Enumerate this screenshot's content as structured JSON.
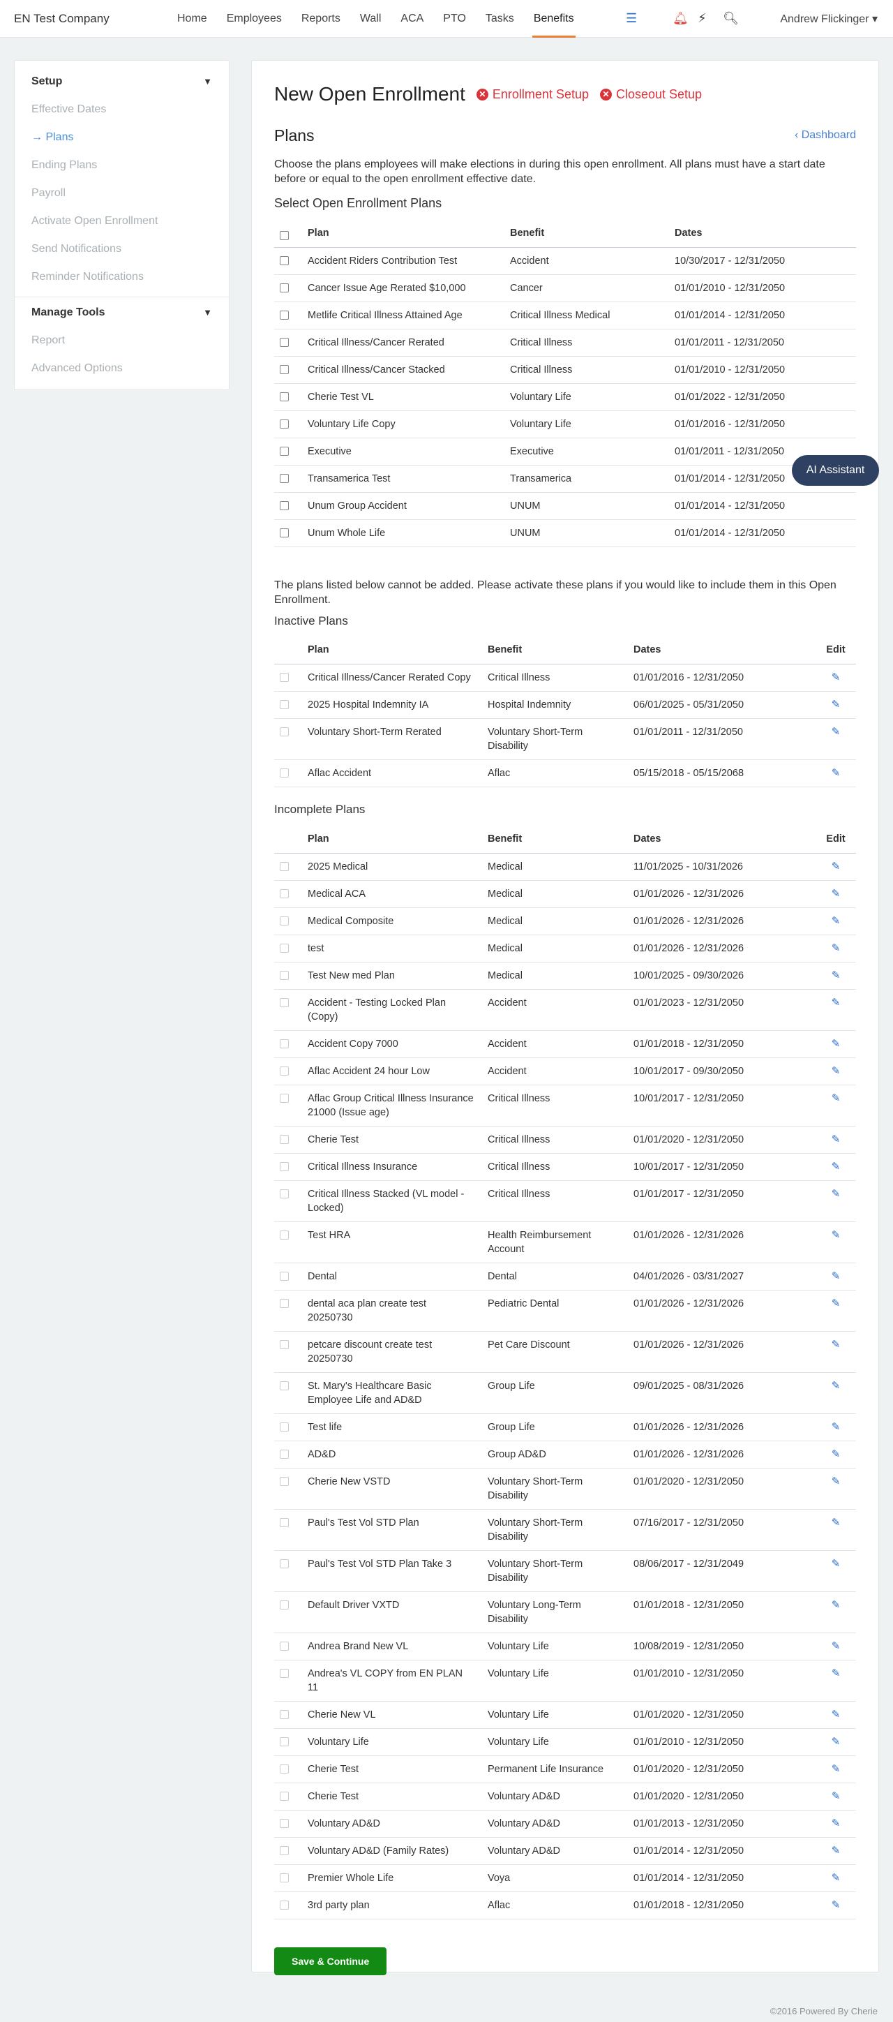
{
  "header": {
    "company": "EN Test Company",
    "nav": [
      "Home",
      "Employees",
      "Reports",
      "Wall",
      "ACA",
      "PTO",
      "Tasks",
      "Benefits"
    ],
    "user": "Andrew Flickinger ▾"
  },
  "sidebar": {
    "setup_title": "Setup",
    "setup_items": [
      "Effective Dates",
      "Plans",
      "Ending Plans",
      "Payroll",
      "Activate Open Enrollment",
      "Send Notifications",
      "Reminder Notifications"
    ],
    "tools_title": "Manage Tools",
    "tools_items": [
      "Report",
      "Advanced Options"
    ]
  },
  "page": {
    "title": "New Open Enrollment",
    "enroll_setup": "Enrollment Setup",
    "closeout_setup": "Closeout Setup",
    "plans_heading": "Plans",
    "dashboard_link": "Dashboard",
    "intro": "Choose the plans employees will make elections in during this open enrollment. All plans must have a start date before or equal to the open enrollment effective date.",
    "select_heading": "Select Open Enrollment Plans",
    "notice": "The plans listed below cannot be added. Please activate these plans if you would like to include them in this Open Enrollment.",
    "inactive_heading": "Inactive Plans",
    "incomplete_heading": "Incomplete Plans",
    "save_button": "Save & Continue",
    "ai_button": "AI Assistant",
    "footer": "©2016 Powered By Cherie"
  },
  "columns": {
    "plan": "Plan",
    "benefit": "Benefit",
    "dates": "Dates",
    "edit": "Edit"
  },
  "select_plans": [
    [
      "Accident Riders Contribution Test",
      "Accident",
      "10/30/2017 - 12/31/2050"
    ],
    [
      "Cancer Issue Age Rerated $10,000",
      "Cancer",
      "01/01/2010 - 12/31/2050"
    ],
    [
      "Metlife Critical Illness Attained Age",
      "Critical Illness Medical",
      "01/01/2014 - 12/31/2050"
    ],
    [
      "Critical Illness/Cancer Rerated",
      "Critical Illness",
      "01/01/2011 - 12/31/2050"
    ],
    [
      "Critical Illness/Cancer Stacked",
      "Critical Illness",
      "01/01/2010 - 12/31/2050"
    ],
    [
      "Cherie Test VL",
      "Voluntary Life",
      "01/01/2022 - 12/31/2050"
    ],
    [
      "Voluntary Life Copy",
      "Voluntary Life",
      "01/01/2016 - 12/31/2050"
    ],
    [
      "Executive",
      "Executive",
      "01/01/2011 - 12/31/2050"
    ],
    [
      "Transamerica Test",
      "Transamerica",
      "01/01/2014 - 12/31/2050"
    ],
    [
      "Unum Group Accident",
      "UNUM",
      "01/01/2014 - 12/31/2050"
    ],
    [
      "Unum Whole Life",
      "UNUM",
      "01/01/2014 - 12/31/2050"
    ]
  ],
  "inactive_plans": [
    [
      "Critical Illness/Cancer Rerated Copy",
      "Critical Illness",
      "01/01/2016 - 12/31/2050"
    ],
    [
      "2025 Hospital Indemnity IA",
      "Hospital Indemnity",
      "06/01/2025 - 05/31/2050"
    ],
    [
      "Voluntary Short-Term Rerated",
      "Voluntary Short-Term Disability",
      "01/01/2011 - 12/31/2050"
    ],
    [
      "Aflac Accident",
      "Aflac",
      "05/15/2018 - 05/15/2068"
    ]
  ],
  "incomplete_plans": [
    [
      "2025 Medical",
      "Medical",
      "11/01/2025 - 10/31/2026"
    ],
    [
      "Medical ACA",
      "Medical",
      "01/01/2026 - 12/31/2026"
    ],
    [
      "Medical Composite",
      "Medical",
      "01/01/2026 - 12/31/2026"
    ],
    [
      "test",
      "Medical",
      "01/01/2026 - 12/31/2026"
    ],
    [
      "Test New med Plan",
      "Medical",
      "10/01/2025 - 09/30/2026"
    ],
    [
      "Accident - Testing Locked Plan (Copy)",
      "Accident",
      "01/01/2023 - 12/31/2050"
    ],
    [
      "Accident Copy 7000",
      "Accident",
      "01/01/2018 - 12/31/2050"
    ],
    [
      "Aflac Accident 24 hour Low",
      "Accident",
      "10/01/2017 - 09/30/2050"
    ],
    [
      "Aflac Group Critical Illness Insurance 21000 (Issue age)",
      "Critical Illness",
      "10/01/2017 - 12/31/2050"
    ],
    [
      "Cherie Test",
      "Critical Illness",
      "01/01/2020 - 12/31/2050"
    ],
    [
      "Critical Illness Insurance",
      "Critical Illness",
      "10/01/2017 - 12/31/2050"
    ],
    [
      "Critical Illness Stacked (VL model - Locked)",
      "Critical Illness",
      "01/01/2017 - 12/31/2050"
    ],
    [
      "Test HRA",
      "Health Reimbursement Account",
      "01/01/2026 - 12/31/2026"
    ],
    [
      "Dental",
      "Dental",
      "04/01/2026 - 03/31/2027"
    ],
    [
      "dental aca plan create test 20250730",
      "Pediatric Dental",
      "01/01/2026 - 12/31/2026"
    ],
    [
      "petcare discount create test 20250730",
      "Pet Care Discount",
      "01/01/2026 - 12/31/2026"
    ],
    [
      "St. Mary's Healthcare Basic Employee Life and AD&D",
      "Group Life",
      "09/01/2025 - 08/31/2026"
    ],
    [
      "Test life",
      "Group Life",
      "01/01/2026 - 12/31/2026"
    ],
    [
      "AD&D",
      "Group AD&D",
      "01/01/2026 - 12/31/2026"
    ],
    [
      "Cherie New VSTD",
      "Voluntary Short-Term Disability",
      "01/01/2020 - 12/31/2050"
    ],
    [
      "Paul's Test Vol STD Plan",
      "Voluntary Short-Term Disability",
      "07/16/2017 - 12/31/2050"
    ],
    [
      "Paul's Test Vol STD Plan Take 3",
      "Voluntary Short-Term Disability",
      "08/06/2017 - 12/31/2049"
    ],
    [
      "Default Driver VXTD",
      "Voluntary Long-Term Disability",
      "01/01/2018 - 12/31/2050"
    ],
    [
      "Andrea Brand New VL",
      "Voluntary Life",
      "10/08/2019 - 12/31/2050"
    ],
    [
      "Andrea's VL COPY from EN PLAN 11",
      "Voluntary Life",
      "01/01/2010 - 12/31/2050"
    ],
    [
      "Cherie New VL",
      "Voluntary Life",
      "01/01/2020 - 12/31/2050"
    ],
    [
      "Voluntary Life",
      "Voluntary Life",
      "01/01/2010 - 12/31/2050"
    ],
    [
      "Cherie Test",
      "Permanent Life Insurance",
      "01/01/2020 - 12/31/2050"
    ],
    [
      "Cherie Test",
      "Voluntary AD&D",
      "01/01/2020 - 12/31/2050"
    ],
    [
      "Voluntary AD&D",
      "Voluntary AD&D",
      "01/01/2013 - 12/31/2050"
    ],
    [
      "Voluntary AD&D (Family Rates)",
      "Voluntary AD&D",
      "01/01/2014 - 12/31/2050"
    ],
    [
      "Premier Whole Life",
      "Voya",
      "01/01/2014 - 12/31/2050"
    ],
    [
      "3rd party plan",
      "Aflac",
      "01/01/2018 - 12/31/2050"
    ]
  ]
}
